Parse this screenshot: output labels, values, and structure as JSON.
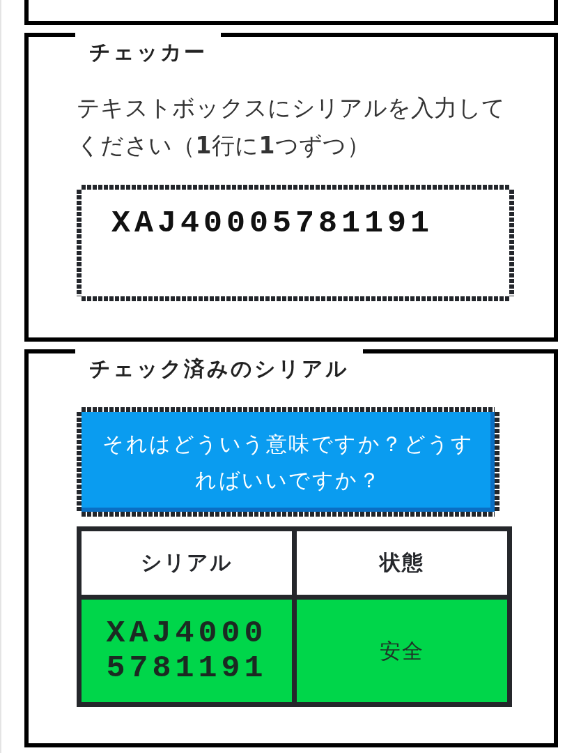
{
  "checker": {
    "title": "チェッカー",
    "instructions": "テキストボックスにシリアルを入力してください（**1**行に**1**つずつ）",
    "serial_input": {
      "value": "XAJ40005781191"
    }
  },
  "checked_serials": {
    "title": "チェック済みのシリアル",
    "help_button": "それはどういう意味ですか？どうすればいいですか？",
    "table": {
      "columns": [
        "シリアル",
        "状態"
      ],
      "rows": [
        {
          "serial": "XAJ40005781191",
          "status": "安全",
          "color": "#00d64a"
        }
      ]
    }
  }
}
